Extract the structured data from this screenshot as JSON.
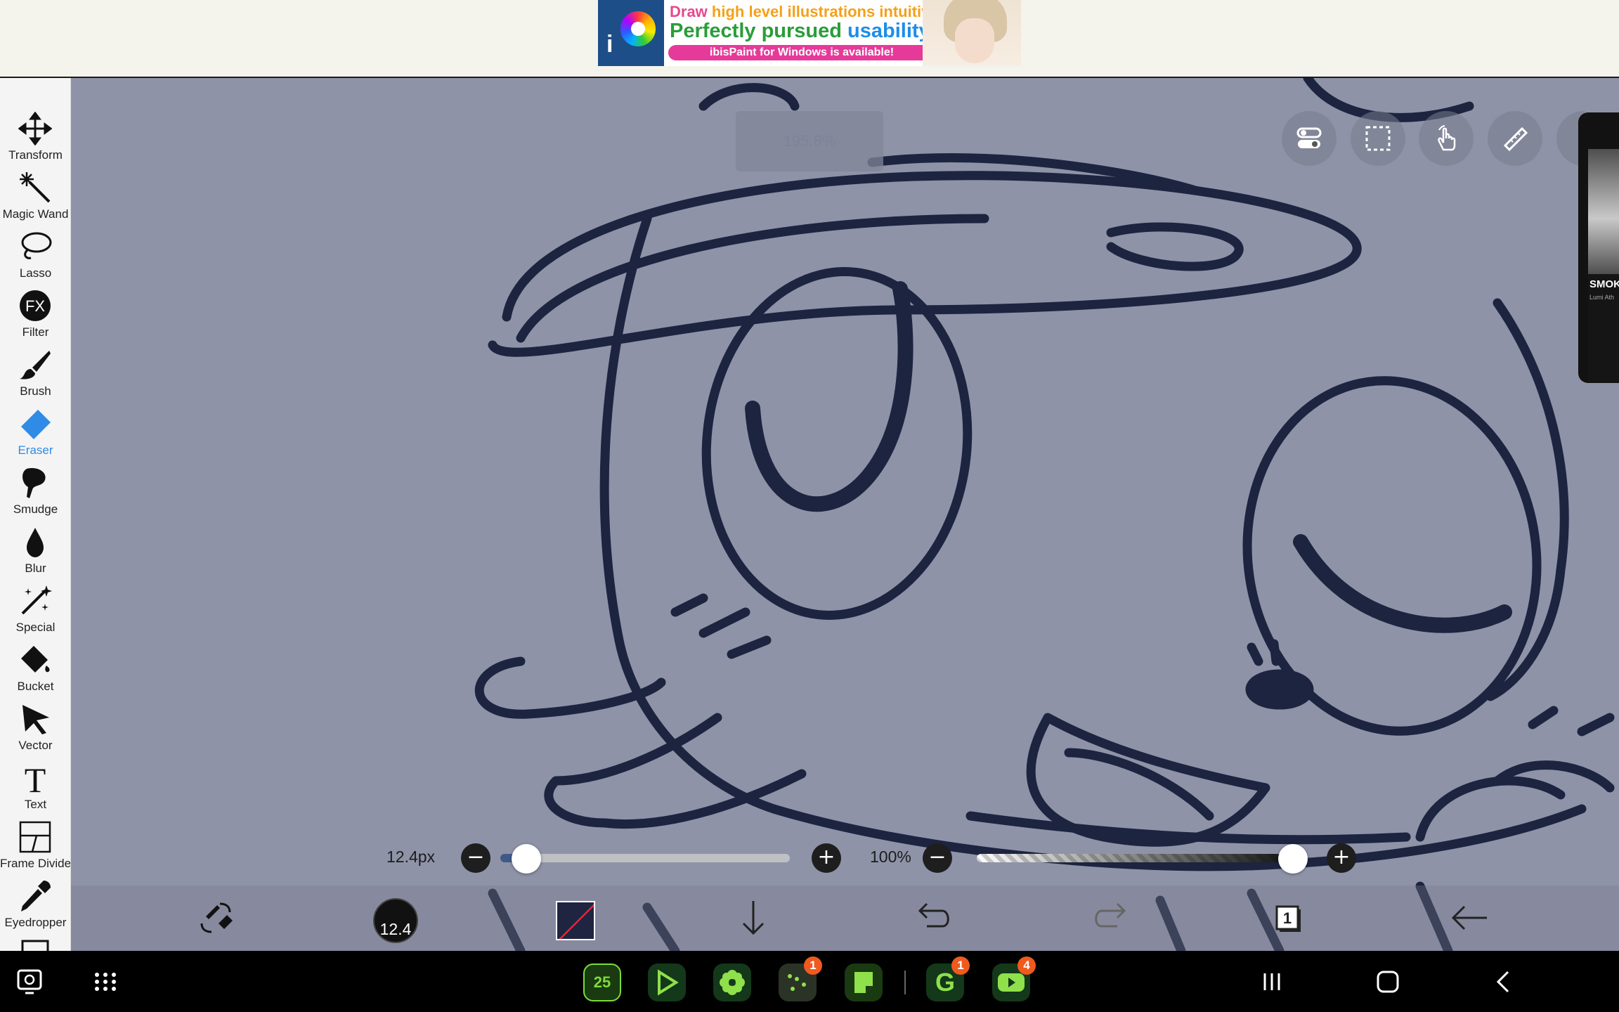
{
  "ad": {
    "line1_part1": "Draw ",
    "line1_part2": "high level illustrations intuitively!",
    "line2_part1": "Perfectly pursued ",
    "line2_part2": "usability!",
    "line3": "ibisPaint for Windows is available!"
  },
  "tools": [
    {
      "label": "Transform",
      "icon": "move-arrows-icon"
    },
    {
      "label": "Magic Wand",
      "icon": "magic-wand-icon"
    },
    {
      "label": "Lasso",
      "icon": "lasso-icon"
    },
    {
      "label": "Filter",
      "icon": "fx-icon"
    },
    {
      "label": "Brush",
      "icon": "brush-icon"
    },
    {
      "label": "Eraser",
      "icon": "eraser-icon",
      "active": true
    },
    {
      "label": "Smudge",
      "icon": "smudge-icon"
    },
    {
      "label": "Blur",
      "icon": "blur-drop-icon"
    },
    {
      "label": "Special",
      "icon": "special-sparkle-icon"
    },
    {
      "label": "Bucket",
      "icon": "bucket-icon"
    },
    {
      "label": "Vector",
      "icon": "cursor-arrow-icon"
    },
    {
      "label": "Text",
      "icon": "text-t-icon"
    },
    {
      "label": "Frame Divider",
      "icon": "frame-divider-icon"
    },
    {
      "label": "Eyedropper",
      "icon": "eyedropper-icon"
    }
  ],
  "canvas": {
    "zoom_text": "195.8%"
  },
  "mini_player": {
    "title": "SMOK",
    "artist": "Lumi Ath"
  },
  "size_slider": {
    "value_text": "12.4px",
    "minus": "−",
    "plus": "+",
    "position_fraction": 0.09
  },
  "opacity_slider": {
    "value_text": "100%",
    "minus": "−",
    "plus": "+",
    "position_fraction": 1.0
  },
  "bottom": {
    "brush_size": "12.4",
    "layer_count": "1"
  },
  "nav_apps": [
    {
      "name": "calendar-app",
      "label": "25"
    },
    {
      "name": "play-store-app",
      "badge": ""
    },
    {
      "name": "flower-app",
      "badge": ""
    },
    {
      "name": "dots-app",
      "badge": "1"
    },
    {
      "name": "notes-app",
      "badge": ""
    },
    {
      "name": "grammarly-app",
      "label": "G",
      "badge": "1"
    },
    {
      "name": "youtube-app",
      "badge": "4"
    }
  ],
  "colors": {
    "accent": "#2f8be6",
    "canvas_bg": "#8f93a8",
    "line_art": "#1c2440"
  }
}
